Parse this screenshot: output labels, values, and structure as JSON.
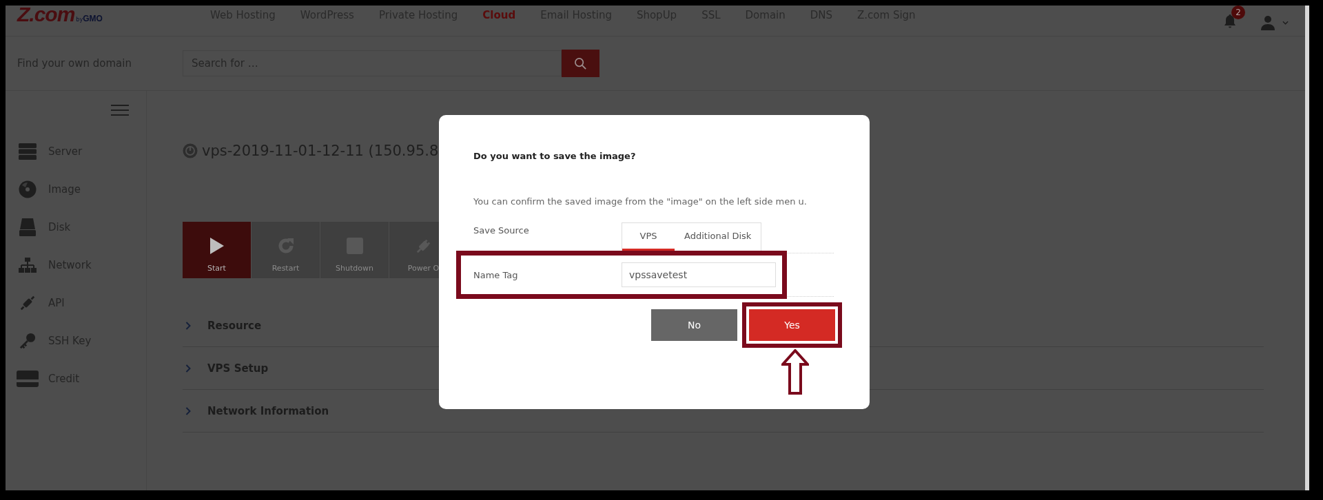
{
  "header": {
    "logo": "Z.com",
    "logo_by": "by",
    "logo_gmo": "GMO",
    "nav": [
      {
        "label": "Web Hosting",
        "selected": false
      },
      {
        "label": "WordPress",
        "selected": false
      },
      {
        "label": "Private Hosting",
        "selected": false
      },
      {
        "label": "Cloud",
        "selected": true
      },
      {
        "label": "Email Hosting",
        "selected": false
      },
      {
        "label": "ShopUp",
        "selected": false
      },
      {
        "label": "SSL",
        "selected": false
      },
      {
        "label": "Domain",
        "selected": false
      },
      {
        "label": "DNS",
        "selected": false
      },
      {
        "label": "Z.com Sign",
        "selected": false
      }
    ],
    "notification_count": "2"
  },
  "domain_search": {
    "label": "Find your own domain",
    "placeholder": "Search for …"
  },
  "sidebar": {
    "items": [
      {
        "label": "Server"
      },
      {
        "label": "Image"
      },
      {
        "label": "Disk"
      },
      {
        "label": "Network"
      },
      {
        "label": "API"
      },
      {
        "label": "SSH Key"
      },
      {
        "label": "Credit"
      }
    ]
  },
  "server": {
    "title": "vps-2019-11-01-12-11 (150.95.8",
    "actions": [
      {
        "label": "Start",
        "disabled": false
      },
      {
        "label": "Restart",
        "disabled": true
      },
      {
        "label": "Shutdown",
        "disabled": true
      },
      {
        "label": "Power O",
        "disabled": true
      }
    ],
    "sections": [
      {
        "label": "Resource",
        "expanded": false
      },
      {
        "label": "VPS Setup",
        "expanded": false
      },
      {
        "label": "Network Information",
        "expanded": false
      }
    ]
  },
  "dialog": {
    "title": "Do you want to save the image?",
    "message": "You can confirm the saved image from the \"image\" on the left side men u.",
    "save_source": {
      "label": "Save Source",
      "tabs": [
        {
          "label": "VPS",
          "selected": true
        },
        {
          "label": "Additional Disk",
          "selected": false
        }
      ]
    },
    "name_tag": {
      "label": "Name Tag",
      "value": "vpssavetest"
    },
    "buttons": [
      {
        "label": "No",
        "kind": "secondary"
      },
      {
        "label": "Yes",
        "kind": "primary"
      }
    ]
  }
}
